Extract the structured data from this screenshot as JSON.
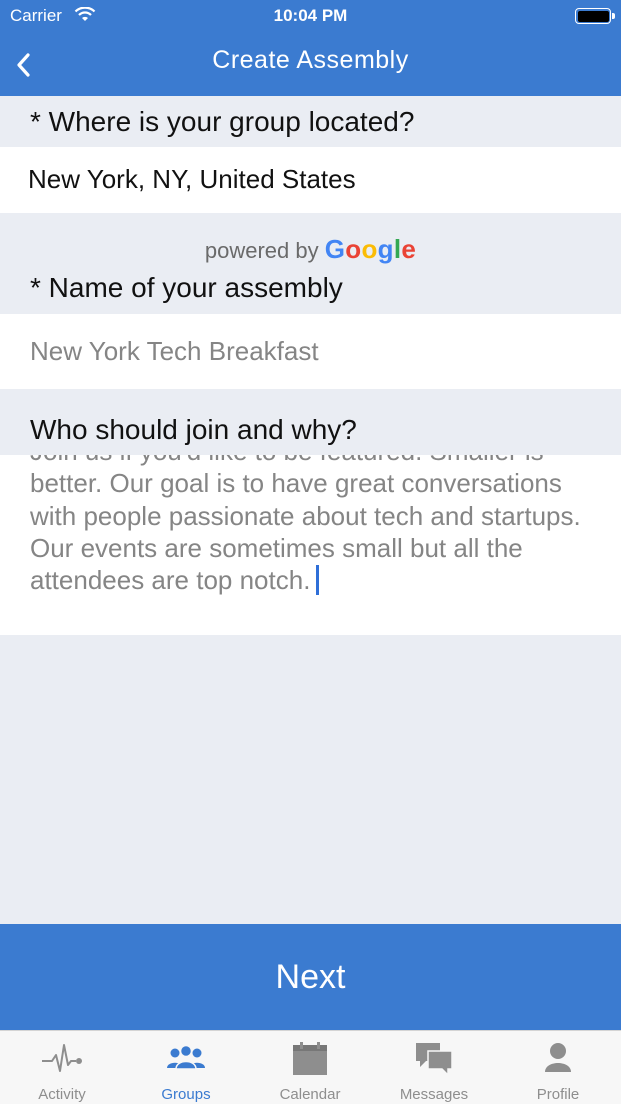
{
  "status_bar": {
    "carrier": "Carrier",
    "time": "10:04 PM"
  },
  "nav": {
    "title": "Create Assembly",
    "back_icon": "chevron-left-icon"
  },
  "location": {
    "label": "* Where is your group located?",
    "value": "New York, NY, United States"
  },
  "attribution": {
    "prefix": "powered by",
    "google_letters": [
      "G",
      "o",
      "o",
      "g",
      "l",
      "e"
    ]
  },
  "assembly_name": {
    "label": "* Name of your assembly",
    "placeholder": "New York Tech Breakfast"
  },
  "description": {
    "label": "Who should join and why?",
    "value": "Join us if you'd like to be featured. Smaller is better.  Our goal is to have great conversations with people passionate about tech and startups. Our events are sometimes small but all the attendees are top notch."
  },
  "next_button": {
    "label": "Next"
  },
  "tabs": [
    {
      "label": "Activity",
      "icon": "activity-icon",
      "active": false
    },
    {
      "label": "Groups",
      "icon": "groups-icon",
      "active": true
    },
    {
      "label": "Calendar",
      "icon": "calendar-icon",
      "active": false
    },
    {
      "label": "Messages",
      "icon": "messages-icon",
      "active": false
    },
    {
      "label": "Profile",
      "icon": "profile-icon",
      "active": false
    }
  ],
  "colors": {
    "primary": "#3b7bd0",
    "background": "#eaedf3",
    "tab_inactive": "#8e8e8e",
    "caret": "#2f6fd8"
  }
}
